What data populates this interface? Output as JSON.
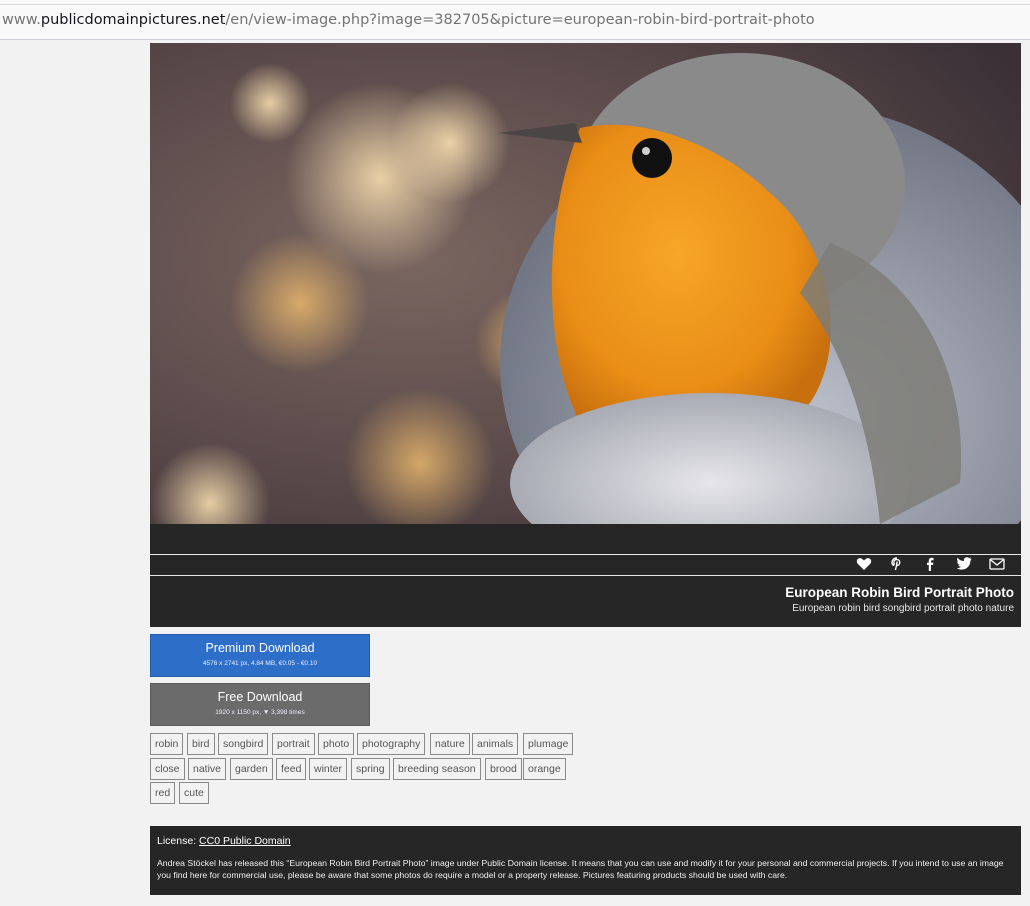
{
  "browser": {
    "url_prefix": "www.",
    "url_host": "publicdomainpictures.net",
    "url_path": "/en/view-image.php?image=382705&picture=european-robin-bird-portrait-photo"
  },
  "social": {
    "icons": [
      "heart-icon",
      "pinterest-icon",
      "facebook-icon",
      "twitter-icon",
      "mail-icon"
    ]
  },
  "image_info": {
    "title": "European Robin Bird Portrait Photo",
    "keywords_line": "European robin bird songbird portrait photo nature"
  },
  "downloads": {
    "premium_label": "Premium Download",
    "premium_details": "4576 x 2741 px, 4.84 MB, €0.05 - €0.10",
    "free_label": "Free Download",
    "free_details": "1920 x 1150 px, ▼ 3,398 times"
  },
  "tags": [
    "robin",
    "bird",
    "songbird",
    "portrait",
    "photo",
    "photography",
    "nature",
    "animals",
    "plumage",
    "close",
    "native",
    "garden",
    "feed",
    "winter",
    "spring",
    "breeding season",
    "brood",
    "orange",
    "red",
    "cute"
  ],
  "license": {
    "prefix": "License: ",
    "link": "CC0 Public Domain",
    "text": "Andrea Stöckel has released this “European Robin Bird Portrait Photo” image under Public Domain license. It means that you can use and modify it for your personal and commercial projects. If you intend to use an image you find here for commercial use, please be aware that some photos do require a model or a property release. Pictures featuring products should be used with care."
  },
  "colors": {
    "dark_panel": "#262626",
    "premium_blue": "#2d6ec9",
    "free_gray": "#6b6b6b"
  }
}
